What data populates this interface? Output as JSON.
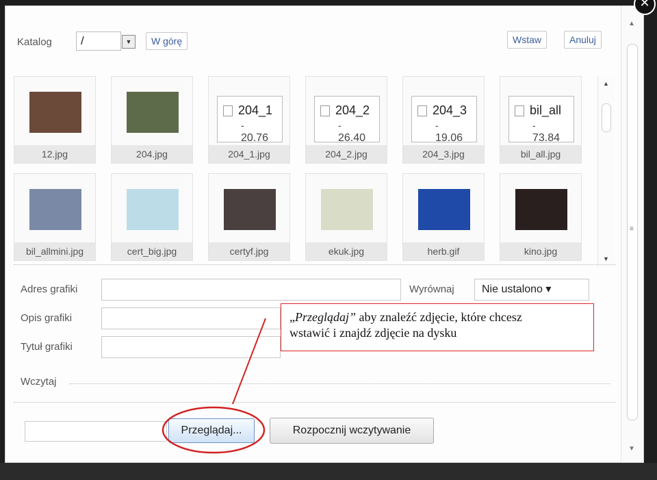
{
  "toolbar": {
    "dir_label": "Katalog",
    "dir_value": "/",
    "up_button": "W górę",
    "insert_button": "Wstaw",
    "cancel_button": "Anuluj"
  },
  "files": [
    {
      "name": "12.jpg",
      "kind": "photo",
      "color": "#6b4a3a"
    },
    {
      "name": "204.jpg",
      "kind": "photo",
      "color": "#5d6b4a"
    },
    {
      "name": "204_1.jpg",
      "kind": "file",
      "preview": "204_1",
      "line2": "-",
      "line3": "20.76"
    },
    {
      "name": "204_2.jpg",
      "kind": "file",
      "preview": "204_2",
      "line2": "-",
      "line3": "26.40"
    },
    {
      "name": "204_3.jpg",
      "kind": "file",
      "preview": "204_3",
      "line2": "-",
      "line3": "19.06"
    },
    {
      "name": "bil_all.jpg",
      "kind": "file",
      "preview": "bil_all",
      "line2": "-",
      "line3": "73.84"
    },
    {
      "name": "bil_allmini.jpg",
      "kind": "photo",
      "color": "#7a8aa6"
    },
    {
      "name": "cert_big.jpg",
      "kind": "photo",
      "color": "#bcdde8"
    },
    {
      "name": "certyf.jpg",
      "kind": "photo",
      "color": "#4a4040"
    },
    {
      "name": "ekuk.jpg",
      "kind": "photo",
      "color": "#d9dcc6"
    },
    {
      "name": "herb.gif",
      "kind": "photo",
      "color": "#1f4aa8"
    },
    {
      "name": "kino.jpg",
      "kind": "photo",
      "color": "#2a1f1f"
    }
  ],
  "form": {
    "address_label": "Adres grafiki",
    "description_label": "Opis grafiki",
    "title_label": "Tytuł grafiki",
    "align_label": "Wyrównaj",
    "align_value": "Nie ustalono",
    "upload_section": "Wczytaj",
    "browse_button": "Przeglądaj...",
    "upload_button": "Rozpocznij wczytywanie"
  },
  "callout": {
    "quoted_open": "„",
    "quoted": "Przeglądaj”",
    "text1": " aby znaleźć zdjęcie, które chcesz",
    "text2": "wstawić i znajdź zdjęcie na dysku"
  },
  "colors": {
    "accent": "#3b5d9b",
    "annotation": "#d22222"
  }
}
